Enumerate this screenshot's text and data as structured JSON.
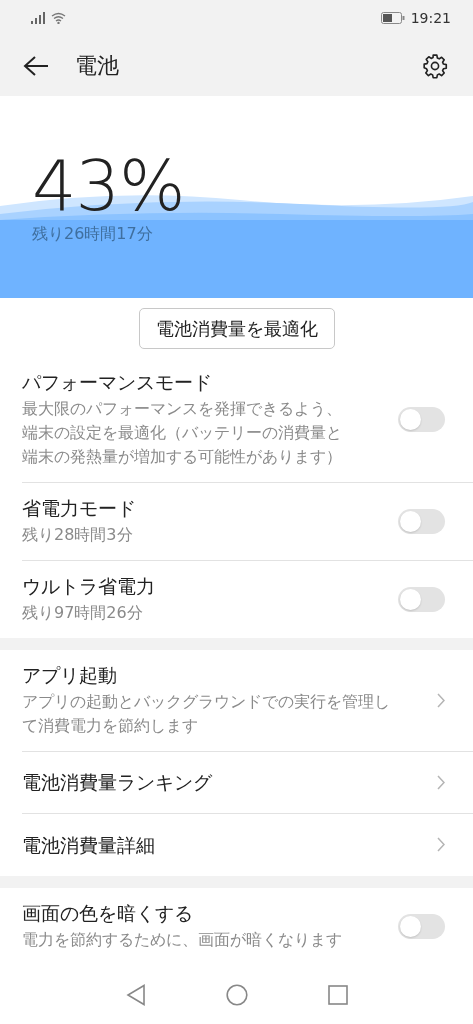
{
  "status_bar": {
    "time": "19:21"
  },
  "app_bar": {
    "title": "電池"
  },
  "battery": {
    "percent": "43%",
    "remaining": "残り26時間17分"
  },
  "optimize_button": "電池消費量を最適化",
  "groups": [
    {
      "items": [
        {
          "kind": "toggle",
          "title": "パフォーマンスモード",
          "subtitle": "最大限のパフォーマンスを発揮できるよう、端末の設定を最適化（バッテリーの消費量と端末の発熱量が増加する可能性があります）",
          "on": false
        },
        {
          "kind": "toggle",
          "title": "省電力モード",
          "subtitle": "残り28時間3分",
          "on": false
        },
        {
          "kind": "toggle",
          "title": "ウルトラ省電力",
          "subtitle": "残り97時間26分",
          "on": false
        }
      ]
    },
    {
      "items": [
        {
          "kind": "link",
          "title": "アプリ起動",
          "subtitle": "アプリの起動とバックグラウンドでの実行を管理して消費電力を節約します"
        },
        {
          "kind": "link",
          "title": "電池消費量ランキング"
        },
        {
          "kind": "link",
          "title": "電池消費量詳細"
        }
      ]
    },
    {
      "items": [
        {
          "kind": "toggle",
          "title": "画面の色を暗くする",
          "subtitle": "電力を節約するために、画面が暗くなります",
          "on": false
        }
      ]
    }
  ]
}
